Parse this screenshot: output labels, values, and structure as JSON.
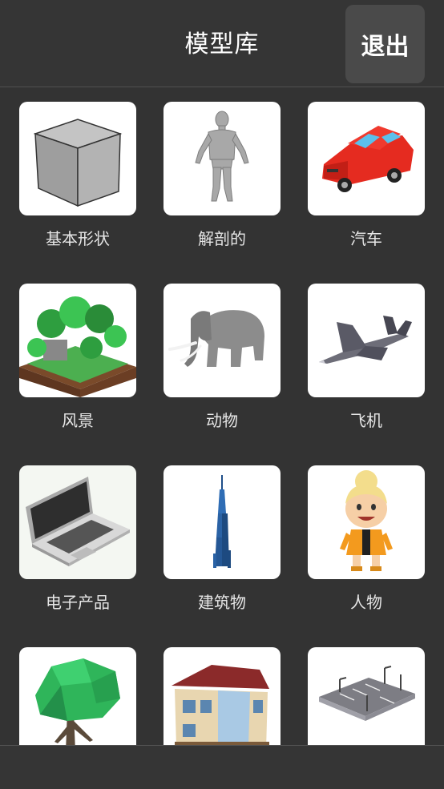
{
  "header": {
    "title": "模型库",
    "exit_label": "退出"
  },
  "categories": [
    {
      "label": "基本形状",
      "icon": "cube-icon"
    },
    {
      "label": "解剖的",
      "icon": "human-figure-icon"
    },
    {
      "label": "汽车",
      "icon": "car-icon"
    },
    {
      "label": "风景",
      "icon": "landscape-icon"
    },
    {
      "label": "动物",
      "icon": "elephant-icon"
    },
    {
      "label": "飞机",
      "icon": "jet-icon"
    },
    {
      "label": "电子产品",
      "icon": "laptop-icon"
    },
    {
      "label": "建筑物",
      "icon": "skyscraper-icon"
    },
    {
      "label": "人物",
      "icon": "cartoon-person-icon"
    },
    {
      "label": "",
      "icon": "tree-icon"
    },
    {
      "label": "",
      "icon": "house-icon"
    },
    {
      "label": "",
      "icon": "parking-lot-icon"
    }
  ]
}
